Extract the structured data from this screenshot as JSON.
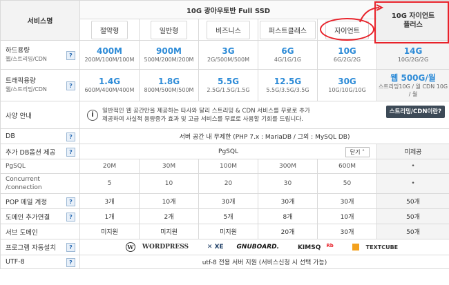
{
  "header": {
    "service_name": "서비스명",
    "group_title": "10G 광아우토반 Full SSD",
    "plans": [
      "절약형",
      "일반형",
      "비즈니스",
      "퍼스트클래스",
      "자이언트"
    ],
    "plus_line1": "10G 자이언트",
    "plus_line2": "플러스"
  },
  "rows": {
    "disk": {
      "label": "하드용량",
      "sub": "웹/스트리밍/CDN",
      "help": "?",
      "values": [
        {
          "big": "400M",
          "sm": "200M/100M/100M"
        },
        {
          "big": "900M",
          "sm": "500M/200M/200M"
        },
        {
          "big": "3G",
          "sm": "2G/500M/500M"
        },
        {
          "big": "6G",
          "sm": "4G/1G/1G"
        },
        {
          "big": "10G",
          "sm": "6G/2G/2G"
        },
        {
          "big": "14G",
          "sm": "10G/2G/2G"
        }
      ]
    },
    "traffic": {
      "label": "트래픽용량",
      "sub": "웹/스트리밍/CDN",
      "help": "?",
      "values": [
        {
          "big": "1.4G",
          "sm": "600M/400M/400M"
        },
        {
          "big": "1.8G",
          "sm": "800M/500M/500M"
        },
        {
          "big": "5.5G",
          "sm": "2.5G/1.5G/1.5G"
        },
        {
          "big": "12.5G",
          "sm": "5.5G/3.5G/3.5G"
        },
        {
          "big": "30G",
          "sm": "10G/10G/10G"
        },
        {
          "big": "웹 500G/월",
          "sm": "스트리밍10G / 월 CDN 10G / 월"
        }
      ]
    },
    "info": {
      "label": "사양 안내",
      "icon": "i",
      "line1": "일반적인 웹 공간만을 제공하는 타사와 달리 스트리밍 & CDN 서비스를 무료로 추가",
      "line2": "제공하여 사실적 용량증가 효과 및 고급 서비스를 무료로 사용할 기회를 드립니다.",
      "button": "스트리밍/CDN이란?"
    },
    "db": {
      "label": "DB",
      "help": "?",
      "value": "서버 공간 내 무제한 (PHP 7.x : MariaDB / 그외 : MySQL DB)"
    },
    "db_option": {
      "label": "추가 DB옵션 제공",
      "help": "?",
      "value": "PgSQL",
      "dropdown": "닫기 ˄",
      "plus": "미제공"
    },
    "pgsql": {
      "label": "PgSQL",
      "values": [
        "20M",
        "30M",
        "100M",
        "300M",
        "600M",
        "•"
      ]
    },
    "concurrent": {
      "label1": "Concurrent",
      "label2": "/connection",
      "values": [
        "5",
        "10",
        "20",
        "30",
        "50",
        "•"
      ]
    },
    "pop": {
      "label": "POP 메일 계정",
      "help": "?",
      "values": [
        "3개",
        "10개",
        "30개",
        "30개",
        "30개",
        "50개"
      ]
    },
    "domain": {
      "label": "도메인 추가연결",
      "help": "?",
      "values": [
        "1개",
        "2개",
        "5개",
        "8개",
        "10개",
        "50개"
      ]
    },
    "subdomain": {
      "label": "서브 도메인",
      "values": [
        "미지원",
        "미지원",
        "미지원",
        "20개",
        "30개",
        "50개"
      ]
    },
    "autoinstall": {
      "label": "프로그램 자동설치",
      "help": "?",
      "logos": [
        "WORDPRESS",
        "✕ XE",
        "GNUBOARD.",
        "KIMSQ",
        "TEXTCUBE"
      ],
      "logo_kimsq_sup": "Rb"
    },
    "utf8": {
      "label": "UTF-8",
      "help": "?",
      "value": "utf-8 전용 서버 지원 (서비스신청 시 선택 가능)"
    }
  },
  "colors": {
    "accent": "#2d8bd7",
    "highlight": "#e8222a"
  }
}
